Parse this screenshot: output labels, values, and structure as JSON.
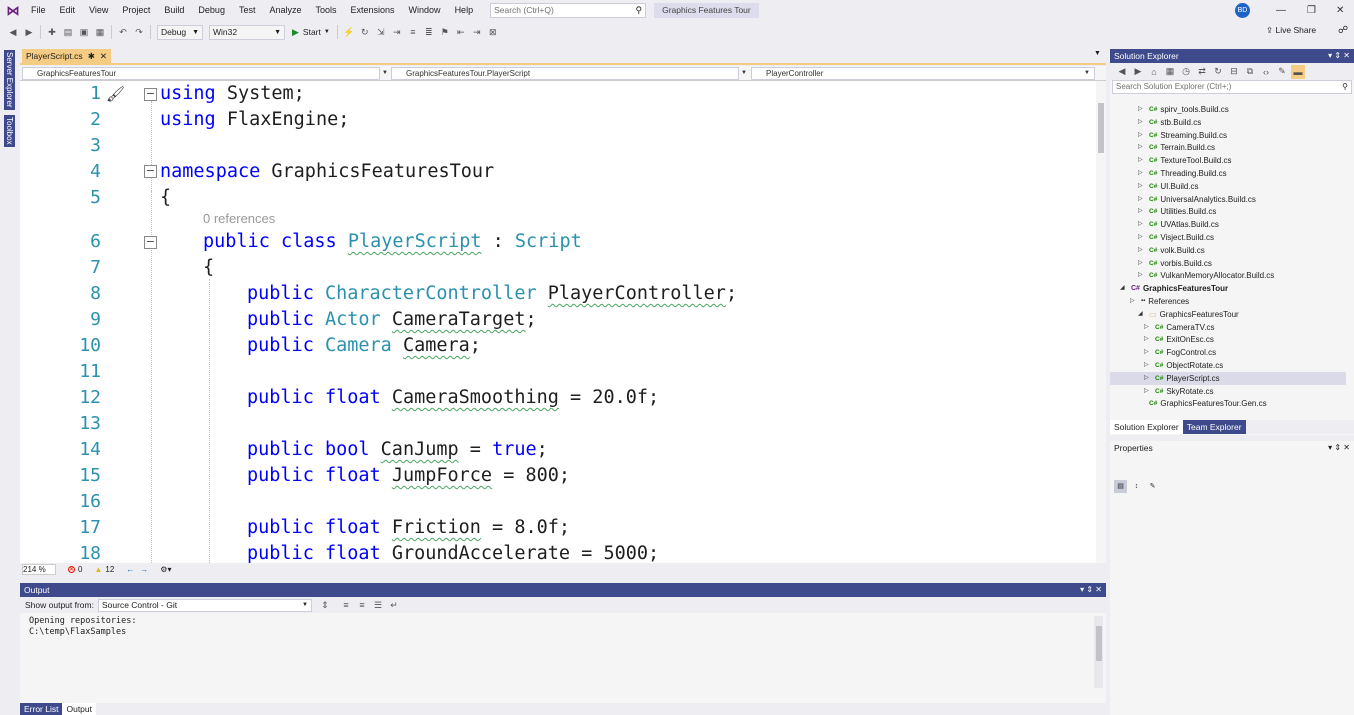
{
  "menubar": {
    "items": [
      "File",
      "Edit",
      "View",
      "Project",
      "Build",
      "Debug",
      "Test",
      "Analyze",
      "Tools",
      "Extensions",
      "Window",
      "Help"
    ],
    "search_placeholder": "Search (Ctrl+Q)",
    "solution_title": "Graphics Features Tour",
    "user_initials": "BD"
  },
  "toolbar": {
    "configuration": "Debug",
    "platform": "Win32",
    "start_label": "Start",
    "live_share": "Live Share"
  },
  "side_tabs": [
    "Server Explorer",
    "Toolbox"
  ],
  "editor": {
    "tab_label": "PlayerScript.cs",
    "tab_pin": "✱",
    "tab_close": "✕",
    "nav_project": "GraphicsFeaturesTour",
    "nav_class": "GraphicsFeaturesTour.PlayerScript",
    "nav_member": "PlayerController",
    "codelens": "0 references",
    "lines": [
      {
        "n": "1",
        "code": "using System;"
      },
      {
        "n": "2",
        "code": "using FlaxEngine;"
      },
      {
        "n": "3",
        "code": ""
      },
      {
        "n": "4",
        "code": "namespace GraphicsFeaturesTour"
      },
      {
        "n": "5",
        "code": "{"
      },
      {
        "n": "6",
        "code": "public class PlayerScript : Script"
      },
      {
        "n": "7",
        "code": "{"
      },
      {
        "n": "8",
        "code": "public CharacterController PlayerController;"
      },
      {
        "n": "9",
        "code": "public Actor CameraTarget;"
      },
      {
        "n": "10",
        "code": "public Camera Camera;"
      },
      {
        "n": "11",
        "code": ""
      },
      {
        "n": "12",
        "code": "public float CameraSmoothing = 20.0f;"
      },
      {
        "n": "13",
        "code": ""
      },
      {
        "n": "14",
        "code": "public bool CanJump = true;"
      },
      {
        "n": "15",
        "code": "public float JumpForce = 800;"
      },
      {
        "n": "16",
        "code": ""
      },
      {
        "n": "17",
        "code": "public float Friction = 8.0f;"
      },
      {
        "n": "18",
        "code": "public float GroundAccelerate = 5000;"
      }
    ],
    "zoom": "214 %",
    "errors": "0",
    "warnings": "12"
  },
  "solution_explorer": {
    "title": "Solution Explorer",
    "search_placeholder": "Search Solution Explorer (Ctrl+;)",
    "items": [
      {
        "label": "spirv_tools.Build.cs",
        "kind": "file"
      },
      {
        "label": "stb.Build.cs",
        "kind": "file"
      },
      {
        "label": "Streaming.Build.cs",
        "kind": "file"
      },
      {
        "label": "Terrain.Build.cs",
        "kind": "file"
      },
      {
        "label": "TextureTool.Build.cs",
        "kind": "file"
      },
      {
        "label": "Threading.Build.cs",
        "kind": "file"
      },
      {
        "label": "UI.Build.cs",
        "kind": "file"
      },
      {
        "label": "UniversalAnalytics.Build.cs",
        "kind": "file"
      },
      {
        "label": "Utilities.Build.cs",
        "kind": "file"
      },
      {
        "label": "UVAtlas.Build.cs",
        "kind": "file"
      },
      {
        "label": "Visject.Build.cs",
        "kind": "file"
      },
      {
        "label": "volk.Build.cs",
        "kind": "file"
      },
      {
        "label": "vorbis.Build.cs",
        "kind": "file"
      },
      {
        "label": "VulkanMemoryAllocator.Build.cs",
        "kind": "file"
      },
      {
        "label": "GraphicsFeaturesTour",
        "kind": "project"
      },
      {
        "label": "References",
        "kind": "refs"
      },
      {
        "label": "GraphicsFeaturesTour",
        "kind": "folder"
      },
      {
        "label": "CameraTV.cs",
        "kind": "cs"
      },
      {
        "label": "ExitOnEsc.cs",
        "kind": "cs"
      },
      {
        "label": "FogControl.cs",
        "kind": "cs"
      },
      {
        "label": "ObjectRotate.cs",
        "kind": "cs"
      },
      {
        "label": "PlayerScript.cs",
        "kind": "cs"
      },
      {
        "label": "SkyRotate.cs",
        "kind": "cs"
      },
      {
        "label": "GraphicsFeaturesTour.Gen.cs",
        "kind": "gen"
      }
    ],
    "tabs": [
      "Solution Explorer",
      "Team Explorer"
    ]
  },
  "properties": {
    "title": "Properties"
  },
  "output": {
    "title": "Output",
    "show_from_label": "Show output from:",
    "source": "Source Control - Git",
    "text": "Opening repositories:\nC:\\temp\\FlaxSamples"
  },
  "bottom_tabs": [
    "Error List",
    "Output"
  ]
}
